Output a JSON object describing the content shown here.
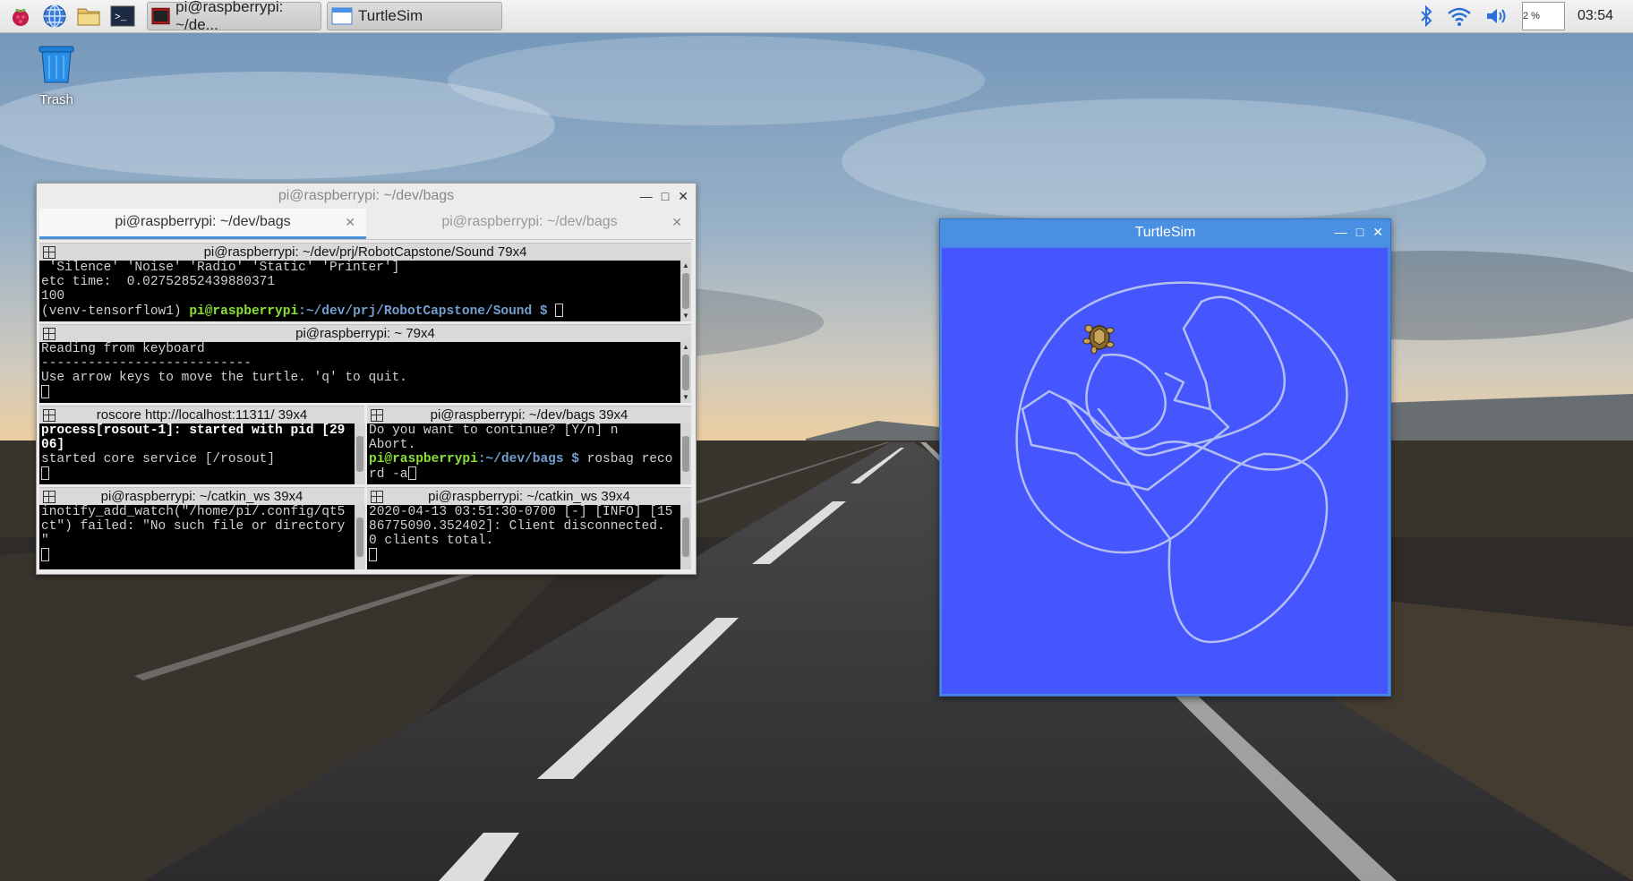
{
  "taskbar": {
    "tasks": [
      {
        "label": "pi@raspberrypi: ~/de..."
      },
      {
        "label": "TurtleSim"
      }
    ],
    "cpu": "2 %",
    "clock": "03:54"
  },
  "desktop": {
    "trash_label": "Trash"
  },
  "terminal": {
    "title": "pi@raspberrypi: ~/dev/bags",
    "tabs": [
      {
        "label": "pi@raspberrypi: ~/dev/bags"
      },
      {
        "label": "pi@raspberrypi: ~/dev/bags"
      }
    ],
    "panes": [
      {
        "header": "pi@raspberrypi: ~/dev/prj/RobotCapstone/Sound 79x4",
        "lines": [
          " 'Silence' 'Noise' 'Radio' 'Static' 'Printer']",
          "etc time:  0.02752852439880371",
          "100"
        ],
        "prompt_env": "(venv-tensorflow1) ",
        "prompt_user": "pi@raspberrypi",
        "prompt_path": ":~/dev/prj/RobotCapstone/Sound $ "
      },
      {
        "header": "pi@raspberrypi: ~ 79x4",
        "lines": [
          "Reading from keyboard",
          "---------------------------",
          "Use arrow keys to move the turtle. 'q' to quit."
        ]
      },
      {
        "header": "roscore http://localhost:11311/ 39x4",
        "bold_lines": [
          "process[rosout-1]: started with pid [29",
          "06]"
        ],
        "lines": [
          "started core service [/rosout]"
        ]
      },
      {
        "header": "pi@raspberrypi: ~/dev/bags 39x4",
        "lines": [
          "Do you want to continue? [Y/n] n",
          "Abort."
        ],
        "prompt_user": "pi@raspberrypi",
        "prompt_path": ":~/dev/bags $ ",
        "prompt_cmd": "rosbag reco",
        "cont": "rd -a"
      },
      {
        "header": "pi@raspberrypi: ~/catkin_ws 39x4",
        "lines": [
          "inotify_add_watch(\"/home/pi/.config/qt5",
          "ct\") failed: \"No such file or directory",
          "\""
        ]
      },
      {
        "header": "pi@raspberrypi: ~/catkin_ws 39x4",
        "lines": [
          "2020-04-13 03:51:30-0700 [-] [INFO] [15",
          "86775090.352402]: Client disconnected.",
          "0 clients total."
        ]
      }
    ]
  },
  "turtlesim": {
    "title": "TurtleSim",
    "background": "#4556ff",
    "pen_color": "#b3bff2"
  }
}
